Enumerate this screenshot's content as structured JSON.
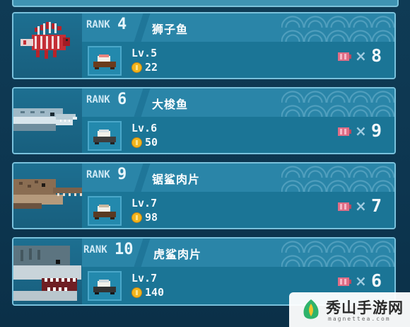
{
  "entries": [
    {
      "rank_label": "RANK",
      "rank": "4",
      "name": "狮子鱼",
      "level": "Lv.5",
      "price": "22",
      "quantity": "8",
      "fish_icon": "lionfish-icon"
    },
    {
      "rank_label": "RANK",
      "rank": "6",
      "name": "大梭鱼",
      "level": "Lv.6",
      "price": "50",
      "quantity": "9",
      "fish_icon": "barracuda-icon"
    },
    {
      "rank_label": "RANK",
      "rank": "9",
      "name": "锯鲨肉片",
      "level": "Lv.7",
      "price": "98",
      "quantity": "7",
      "fish_icon": "sawshark-icon"
    },
    {
      "rank_label": "RANK",
      "rank": "10",
      "name": "虎鲨肉片",
      "level": "Lv.7",
      "price": "140",
      "quantity": "6",
      "fish_icon": "tiger-shark-icon"
    }
  ],
  "multiply_symbol": "×",
  "icons": {
    "coin": "gold-coin-icon",
    "meat": "fish-meat-icon",
    "dish": "sushi-dish-icon"
  },
  "watermark": {
    "cn": "秀山手游网",
    "en": "magnettea.com"
  },
  "colors": {
    "card_border": "#79c1dc",
    "card_header": "#2a85a8",
    "card_body": "#1b7596",
    "background": "#0f3b55",
    "coin": "#f2b51d",
    "meat": "#e06d86"
  }
}
